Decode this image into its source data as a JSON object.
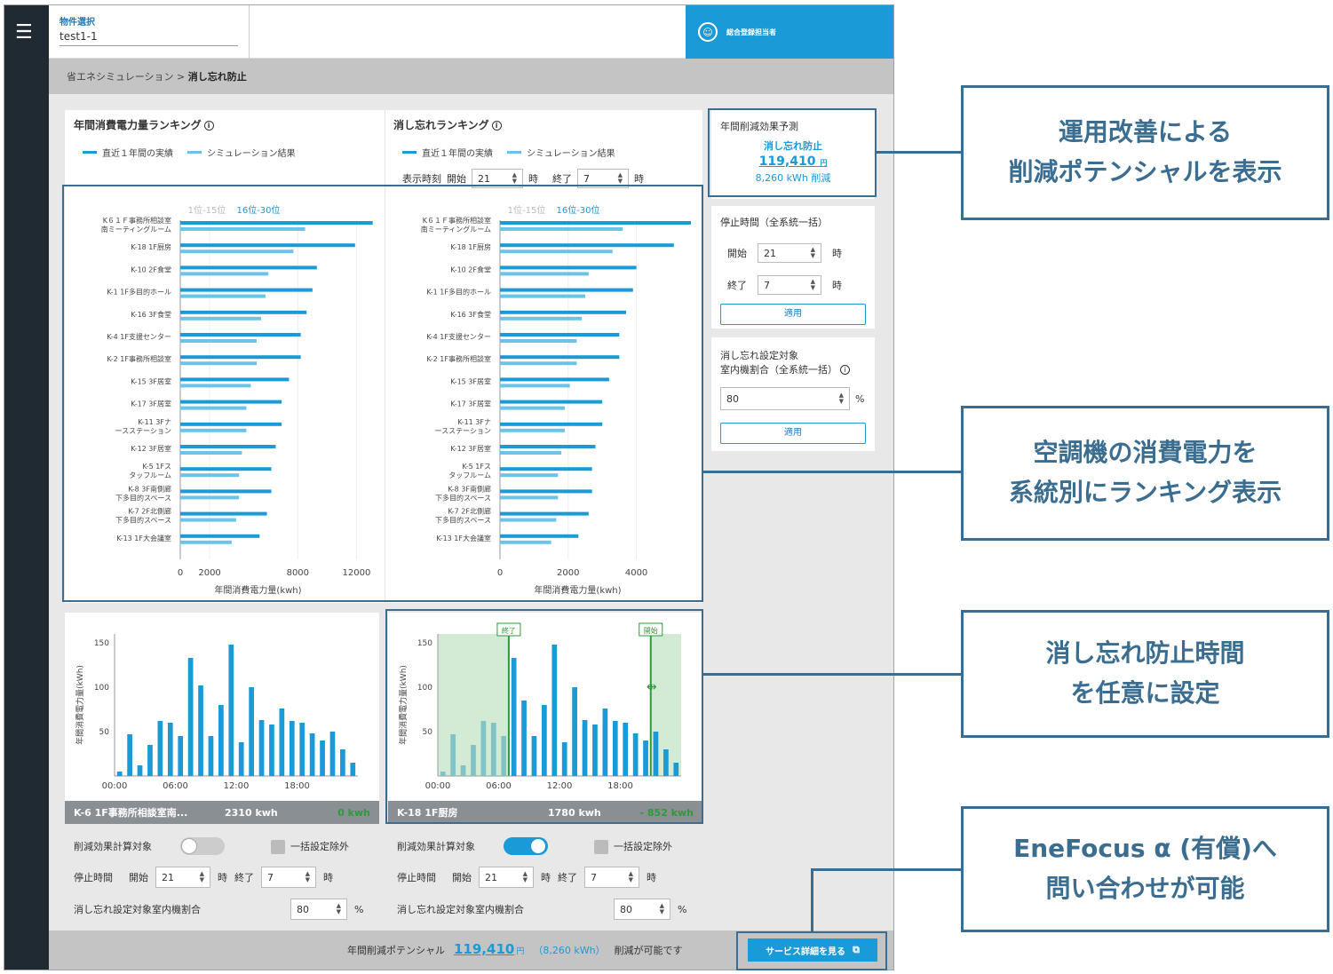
{
  "header": {
    "property_label": "物件選択",
    "property_value": "test1-1",
    "user_name": "総合登録担当者"
  },
  "breadcrumb": {
    "parent": "省エネシミュレーション >",
    "current": "消し忘れ防止"
  },
  "ranking_annual": {
    "title": "年間消費電力量ランキング",
    "legend_actual": "直近１年間の実績",
    "legend_sim": "シミュレーション結果",
    "tab1": "1位-15位",
    "tab2": "16位-30位",
    "xlabel": "年間消費電力量(kwh)"
  },
  "ranking_forgot": {
    "title": "消し忘れランキング",
    "legend_actual": "直近１年間の実績",
    "legend_sim": "シミュレーション結果",
    "time_label": "表示時刻",
    "start_label": "開始",
    "start": "21",
    "hour1": "時",
    "end_label": "終了",
    "end": "7",
    "hour2": "時",
    "tab1": "1位-15位",
    "tab2": "16位-30位",
    "xlabel": "年間消費電力量(kwh)"
  },
  "effect": {
    "title": "年間削減効果予測",
    "name": "消し忘れ防止",
    "yen": "119,410",
    "yen_unit": "円",
    "kwh": "8,260 kWh 削減"
  },
  "stop": {
    "title": "停止時間（全系統一括）",
    "start_label": "開始",
    "start": "21",
    "end_label": "終了",
    "end": "7",
    "hour": "時",
    "apply": "適用"
  },
  "ratio": {
    "title1": "消し忘れ設定対象",
    "title2": "室内機割合（全系統一括）",
    "value": "80",
    "unit": "%",
    "apply": "適用"
  },
  "card_left": {
    "name": "K-6 1F事務所相談室南...",
    "kwh": "2310 kwh",
    "diff": "0 kwh",
    "calc_label": "削減効果計算対象",
    "exclude_label": "一括設定除外",
    "stop_label": "停止時間",
    "start_label": "開始",
    "start": "21",
    "hour": "時",
    "end_label": "終了",
    "end": "7",
    "ratio_label": "消し忘れ設定対象室内機割合",
    "ratio": "80",
    "unit": "%"
  },
  "card_right": {
    "name": "K-18 1F厨房",
    "kwh": "1780 kwh",
    "diff": "- 852 kwh",
    "calc_label": "削減効果計算対象",
    "exclude_label": "一括設定除外",
    "stop_label": "停止時間",
    "start_label": "開始",
    "start": "21",
    "hour": "時",
    "end_label": "終了",
    "end": "7",
    "ratio_label": "消し忘れ設定対象室内機割合",
    "ratio": "80",
    "unit": "%",
    "marker_start": "開始",
    "marker_end": "終了"
  },
  "footer": {
    "label": "年間削減ポテンシャル",
    "yen": "119,410",
    "yen_unit": "円",
    "kwh": "（8,260 kWh）",
    "suffix": "削減が可能です",
    "button": "サービス詳細を見る"
  },
  "annotations": {
    "a1_l1": "運用改善による",
    "a1_l2": "削減ポテンシャルを表示",
    "a2_l1": "空調機の消費電力を",
    "a2_l2": "系統別にランキング表示",
    "a3_l1": "消し忘れ防止時間",
    "a3_l2": "を任意に設定",
    "a4_l1": "EneFocus α (有償)へ",
    "a4_l2": "問い合わせが可能"
  },
  "colors": {
    "actual": "#1a9ad6",
    "sim": "#6cc3ea",
    "accent": "#1a9ad6",
    "annotation": "#3a6d8f",
    "green": "#2e9a3c"
  },
  "chart_data": [
    {
      "type": "bar",
      "title": "年間消費電力量ランキング",
      "xlabel": "年間消費電力量(kwh)",
      "orientation": "horizontal",
      "xlim": [
        0,
        13000
      ],
      "xticks": [
        0,
        2000,
        8000,
        12000
      ],
      "categories": [
        "K６１Ｆ事務所相談室南ミーティングルーム",
        "K-18 1F厨房",
        "K-10 2F食堂",
        "K-1 1F多目的ホール",
        "K-16 3F食堂",
        "K-4 1F支援センター",
        "K-2 1F事務所相談室",
        "K-15 3F居室",
        "K-17 3F居室",
        "K-11 3Fナースステーション",
        "K-12 3F居室",
        "K-5 1Fスタッフルーム",
        "K-8 3F南側廊下多目的スペース",
        "K-7 2F北側廊下多目的スペース",
        "K-13 1F大会議室"
      ],
      "series": [
        {
          "name": "直近１年間の実績",
          "values": [
            13100,
            11900,
            9300,
            9000,
            8600,
            8200,
            8200,
            7400,
            6900,
            6900,
            6500,
            6200,
            6200,
            5900,
            5400
          ]
        },
        {
          "name": "シミュレーション結果",
          "values": [
            8500,
            7700,
            6000,
            5800,
            5500,
            5200,
            5200,
            4800,
            4500,
            4500,
            4200,
            4000,
            4000,
            3800,
            3500
          ]
        }
      ]
    },
    {
      "type": "bar",
      "title": "消し忘れランキング",
      "xlabel": "年間消費電力量(kwh)",
      "orientation": "horizontal",
      "xlim": [
        0,
        5600
      ],
      "xticks": [
        0,
        2000,
        4000
      ],
      "categories": [
        "K６１Ｆ事務所相談室南ミーティングルーム",
        "K-18 1F厨房",
        "K-10 2F食堂",
        "K-1 1F多目的ホール",
        "K-16 3F食堂",
        "K-4 1F支援センター",
        "K-2 1F事務所相談室",
        "K-15 3F居室",
        "K-17 3F居室",
        "K-11 3Fナースステーション",
        "K-12 3F居室",
        "K-5 1Fスタッフルーム",
        "K-8 3F南側廊下多目的スペース",
        "K-7 2F北側廊下多目的スペース",
        "K-13 1F大会議室"
      ],
      "series": [
        {
          "name": "直近１年間の実績",
          "values": [
            5600,
            5100,
            4000,
            3900,
            3700,
            3500,
            3500,
            3200,
            3000,
            3000,
            2800,
            2700,
            2700,
            2600,
            2300
          ]
        },
        {
          "name": "シミュレーション結果",
          "values": [
            3600,
            3300,
            2600,
            2500,
            2400,
            2250,
            2250,
            2050,
            1900,
            1900,
            1800,
            1700,
            1700,
            1650,
            1500
          ]
        }
      ]
    },
    {
      "type": "bar",
      "ylabel": "年間消費電力量(kWh)",
      "ylim": [
        0,
        160
      ],
      "yticks": [
        50,
        100,
        150
      ],
      "xticks": [
        "00:00",
        "06:00",
        "12:00",
        "18:00"
      ],
      "values": [
        5,
        47,
        12,
        35,
        62,
        60,
        45,
        133,
        102,
        45,
        80,
        148,
        38,
        100,
        63,
        58,
        76,
        62,
        60,
        48,
        40,
        50,
        30,
        15
      ]
    },
    {
      "type": "bar",
      "ylabel": "年間消費電力量(kWh)",
      "ylim": [
        0,
        160
      ],
      "yticks": [
        50,
        100,
        150
      ],
      "xticks": [
        "00:00",
        "06:00",
        "12:00",
        "18:00"
      ],
      "values": [
        5,
        47,
        12,
        35,
        62,
        60,
        45,
        133,
        85,
        45,
        80,
        148,
        38,
        100,
        63,
        58,
        76,
        62,
        60,
        48,
        40,
        50,
        30,
        15
      ],
      "highlight_start_hour": 21,
      "highlight_end_hour": 7
    }
  ]
}
